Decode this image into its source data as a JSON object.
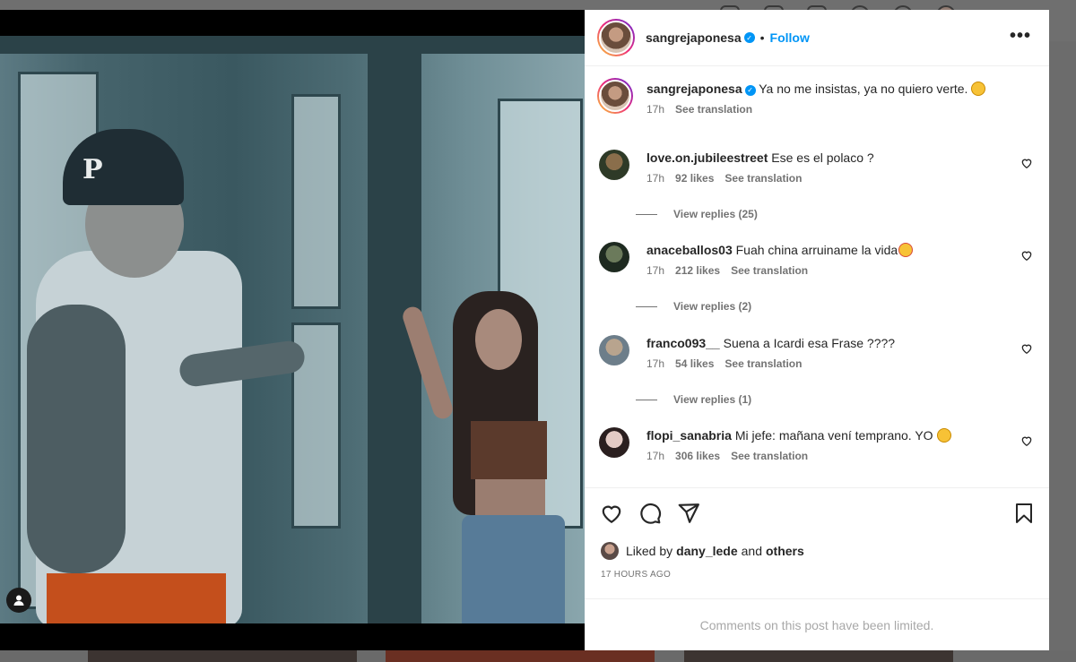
{
  "post": {
    "author": "sangrejaponesa",
    "follow_label": "Follow",
    "separator": "•",
    "more_label": "•••",
    "caption": {
      "username": "sangrejaponesa",
      "text": "Ya no me insistas, ya no quiero verte.",
      "emoji": "smiling-face",
      "age": "17h",
      "translate": "See translation"
    },
    "photo": {
      "cap_letter": "P"
    }
  },
  "comments": [
    {
      "username": "love.on.jubileestreet",
      "text": "Ese es el polaco ?",
      "age": "17h",
      "likes": "92 likes",
      "translate": "See translation",
      "replies": "View replies (25)"
    },
    {
      "username": "anaceballos03",
      "text": "Fuah china arruiname la vida",
      "emoji": "star-struck",
      "age": "17h",
      "likes": "212 likes",
      "translate": "See translation",
      "replies": "View replies (2)"
    },
    {
      "username": "franco093__",
      "text": "Suena a Icardi esa Frase ????",
      "age": "17h",
      "likes": "54 likes",
      "translate": "See translation",
      "replies": "View replies (1)"
    },
    {
      "username": "flopi_sanabria",
      "text": "Mi jefe: mañana vení temprano. YO",
      "emoji": "laughing",
      "age": "17h",
      "likes": "306 likes",
      "translate": "See translation"
    }
  ],
  "footer": {
    "liked_prefix": "Liked by",
    "liked_user": "dany_lede",
    "liked_and": "and",
    "liked_others": "others",
    "timestamp": "17 HOURS AGO",
    "limited_notice": "Comments on this post have been limited."
  },
  "colors": {
    "accent": "#0095f6",
    "muted": "#737373",
    "verified": "#0095f6"
  }
}
